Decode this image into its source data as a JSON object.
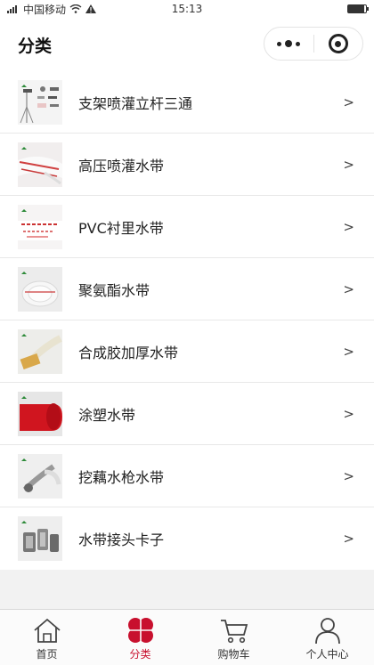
{
  "status_bar": {
    "carrier": "中国移动",
    "time": "15:13",
    "battery_level": 0.9
  },
  "header": {
    "title": "分类"
  },
  "categories": [
    {
      "label": "支架喷灌立杆三通",
      "arrow": ">"
    },
    {
      "label": "高压喷灌水带",
      "arrow": ">"
    },
    {
      "label": "PVC衬里水带",
      "arrow": ">"
    },
    {
      "label": "聚氨酯水带",
      "arrow": ">"
    },
    {
      "label": "合成胶加厚水带",
      "arrow": ">"
    },
    {
      "label": "涂塑水带",
      "arrow": ">"
    },
    {
      "label": "挖藕水枪水带",
      "arrow": ">"
    },
    {
      "label": "水带接头卡子",
      "arrow": ">"
    }
  ],
  "tabbar": {
    "items": [
      {
        "label": "首页",
        "icon": "home-icon",
        "active": false
      },
      {
        "label": "分类",
        "icon": "category-icon",
        "active": true
      },
      {
        "label": "购物车",
        "icon": "cart-icon",
        "active": false
      },
      {
        "label": "个人中心",
        "icon": "user-icon",
        "active": false
      }
    ]
  },
  "colors": {
    "accent": "#c8102e",
    "background": "#f2f2f2",
    "text": "#222222"
  }
}
